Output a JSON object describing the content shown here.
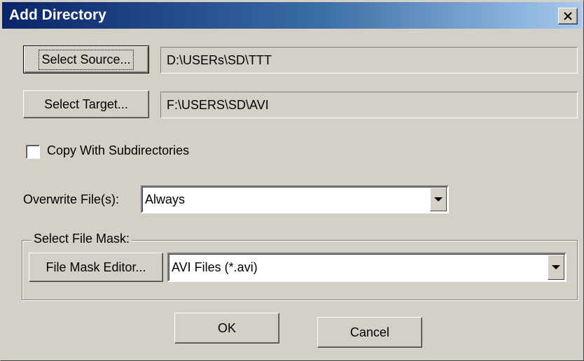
{
  "window": {
    "title": "Add Directory",
    "close_label": "✕"
  },
  "source": {
    "button_label": "Select Source...",
    "path": "D:\\USERs\\SD\\TTT"
  },
  "target": {
    "button_label": "Select Target...",
    "path": "F:\\USERS\\SD\\AVI"
  },
  "copy_subdirs": {
    "label": "Copy With Subdirectories",
    "checked": false
  },
  "overwrite": {
    "label": "Overwrite File(s):",
    "selected": "Always"
  },
  "file_mask": {
    "group_label": "Select File Mask:",
    "editor_button_label": "File Mask Editor...",
    "selected": "AVI Files (*.avi)"
  },
  "actions": {
    "ok_label": "OK",
    "cancel_label": "Cancel"
  }
}
